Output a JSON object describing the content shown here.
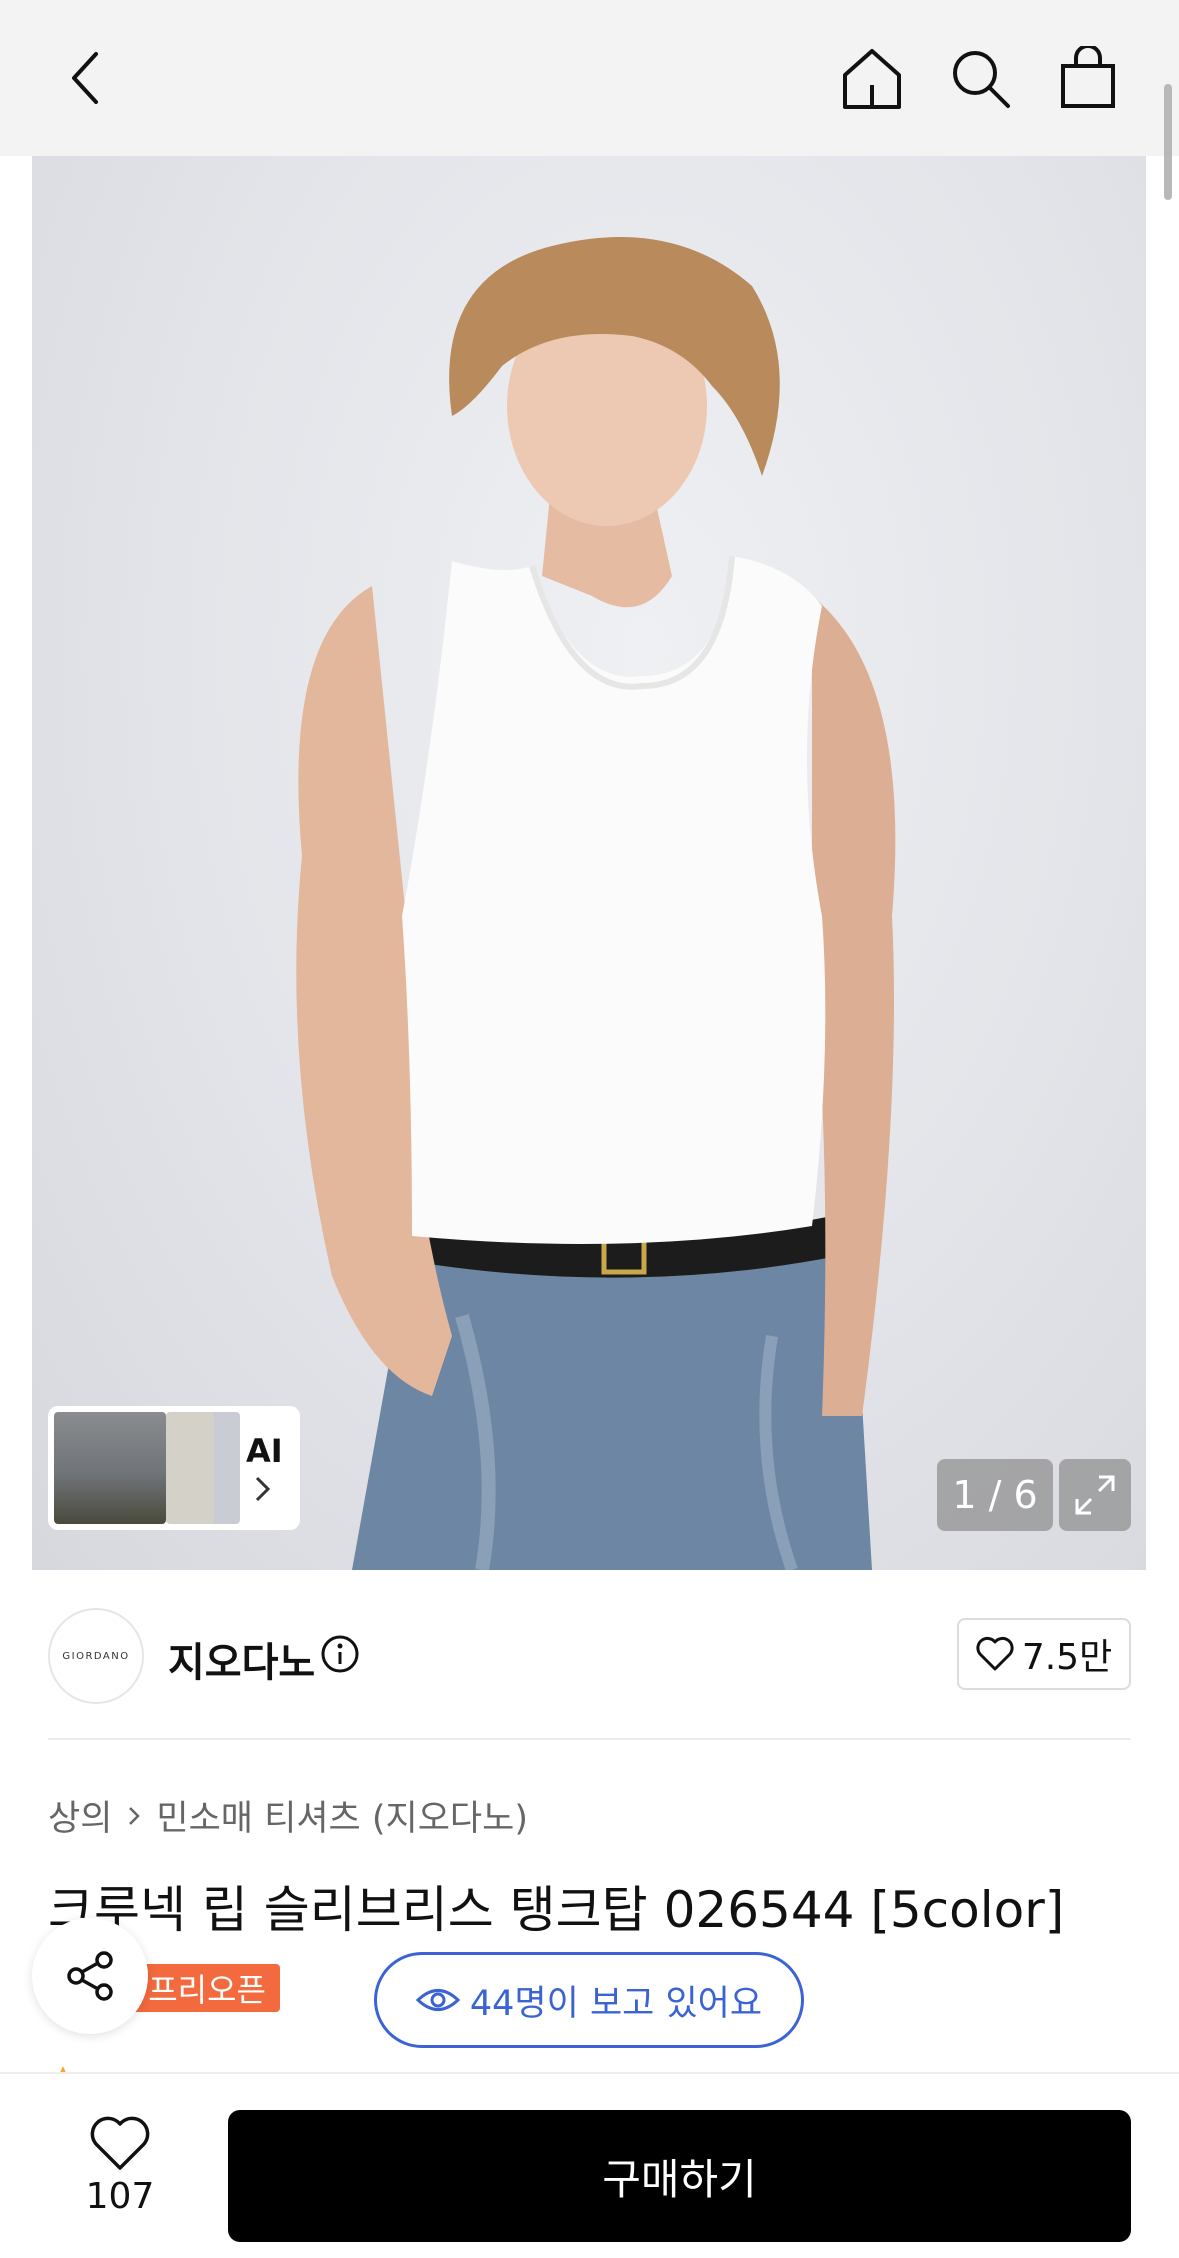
{
  "header": {
    "back_icon": "chevron-left-icon",
    "home_icon": "home-icon",
    "search_icon": "search-icon",
    "cart_icon": "shopping-bag-icon"
  },
  "gallery": {
    "counter": "1 / 6",
    "ai_label": "AI",
    "expand_icon": "expand-icon"
  },
  "brand": {
    "logo_text": "GIORDANO",
    "name": "지오다노",
    "like_count": "7.5만"
  },
  "product": {
    "breadcrumb": [
      "상의",
      "민소매 티셔츠 (지오다노)"
    ],
    "title": "크루넥 립 슬리브리스 탱크탑 026544 [5color]",
    "badge": "프리오픈",
    "viewers": "44명이 보고 있어요"
  },
  "bottom": {
    "wish_count": "107",
    "buy_label": "구매하기"
  },
  "colors": {
    "badge": "#f26a3d",
    "viewers_accent": "#3b63d4",
    "buy_button": "#000000"
  }
}
